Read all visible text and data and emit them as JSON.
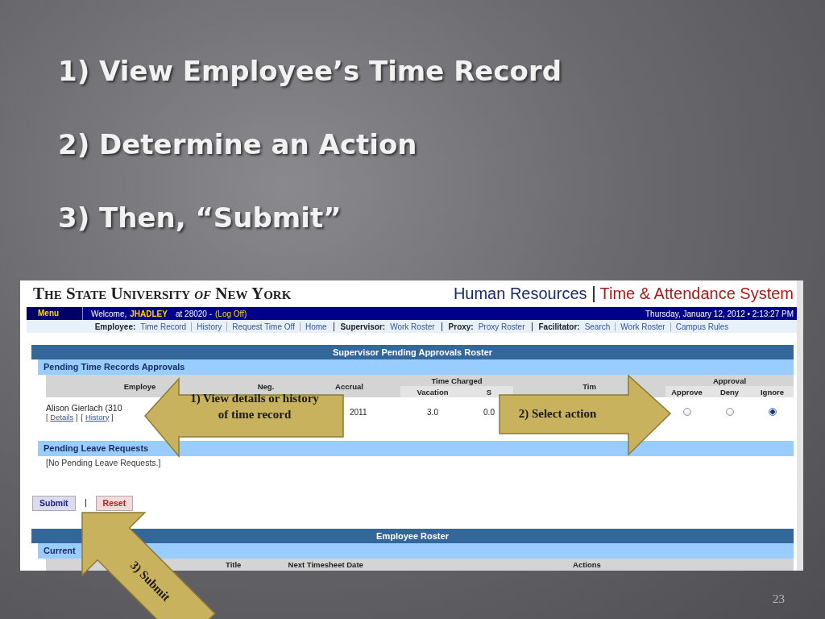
{
  "slide": {
    "steps": [
      "1) View Employee’s Time Record",
      "2) Determine an Action",
      "3) Then, “Submit”"
    ],
    "page_number": "23"
  },
  "app": {
    "logo": "The State University *of* New York",
    "title": "Human Resources",
    "subtitle": "Time & Attendance System",
    "nav": {
      "menu": "Menu",
      "welcome": "Welcome,",
      "user": "JHADLEY",
      "location": "at 28020 -",
      "logoff": "(Log Off)",
      "datetime": "Thursday, January 12, 2012 • 2:13:27 PM"
    },
    "link_groups": [
      {
        "label": "Employee:",
        "links": [
          "Time Record",
          "History",
          "Request Time Off",
          "Home"
        ]
      },
      {
        "label": "Supervisor:",
        "links": [
          "Work Roster"
        ]
      },
      {
        "label": "Proxy:",
        "links": [
          "Proxy Roster"
        ]
      },
      {
        "label": "Facilitator:",
        "links": [
          "Search",
          "Work Roster",
          "Campus Rules"
        ]
      }
    ],
    "roster": {
      "title": "Supervisor Pending Approvals Roster",
      "pending": {
        "title": "Pending Time Records Approvals",
        "header_groups": [
          {
            "text": "Employe"
          },
          {
            "text": "Neg."
          },
          {
            "text": "Accrual"
          },
          {
            "text": "Time Charged",
            "children": [
              "Vacation",
              "S"
            ]
          },
          {
            "text": "Tim"
          },
          {
            "text": "Approval",
            "children": [
              "Approve",
              "Deny",
              "Ignore"
            ]
          }
        ],
        "rows": [
          {
            "name": "Alison Gierlach (310",
            "links": [
              {
                "before": "[",
                "label": "Details",
                "after": "]"
              },
              {
                "before": "[",
                "label": "History",
                "after": "]"
              }
            ],
            "values": [
              "2011",
              "3.0",
              "0.0"
            ],
            "approvals": [
              {
                "selected": false
              },
              {
                "selected": false
              },
              {
                "selected": true
              }
            ]
          }
        ]
      },
      "leave": {
        "title": "Pending Leave Requests",
        "message": "[No Pending Leave Requests.]"
      }
    },
    "buttons": [
      {
        "label": "Submit",
        "kind": "submit"
      },
      {
        "label": "Reset",
        "kind": "reset"
      }
    ],
    "employee_roster": {
      "title": "Employee Roster",
      "section": "Current",
      "columns": [
        "Title",
        "Next Timesheet Date",
        "Actions"
      ]
    }
  },
  "callouts": [
    {
      "kind": "left",
      "lines": [
        "1)  View details or history",
        "of time record"
      ]
    },
    {
      "kind": "right",
      "lines": [
        "2) Select action"
      ]
    },
    {
      "kind": "up-left",
      "lines": [
        "3) Submit"
      ]
    }
  ]
}
